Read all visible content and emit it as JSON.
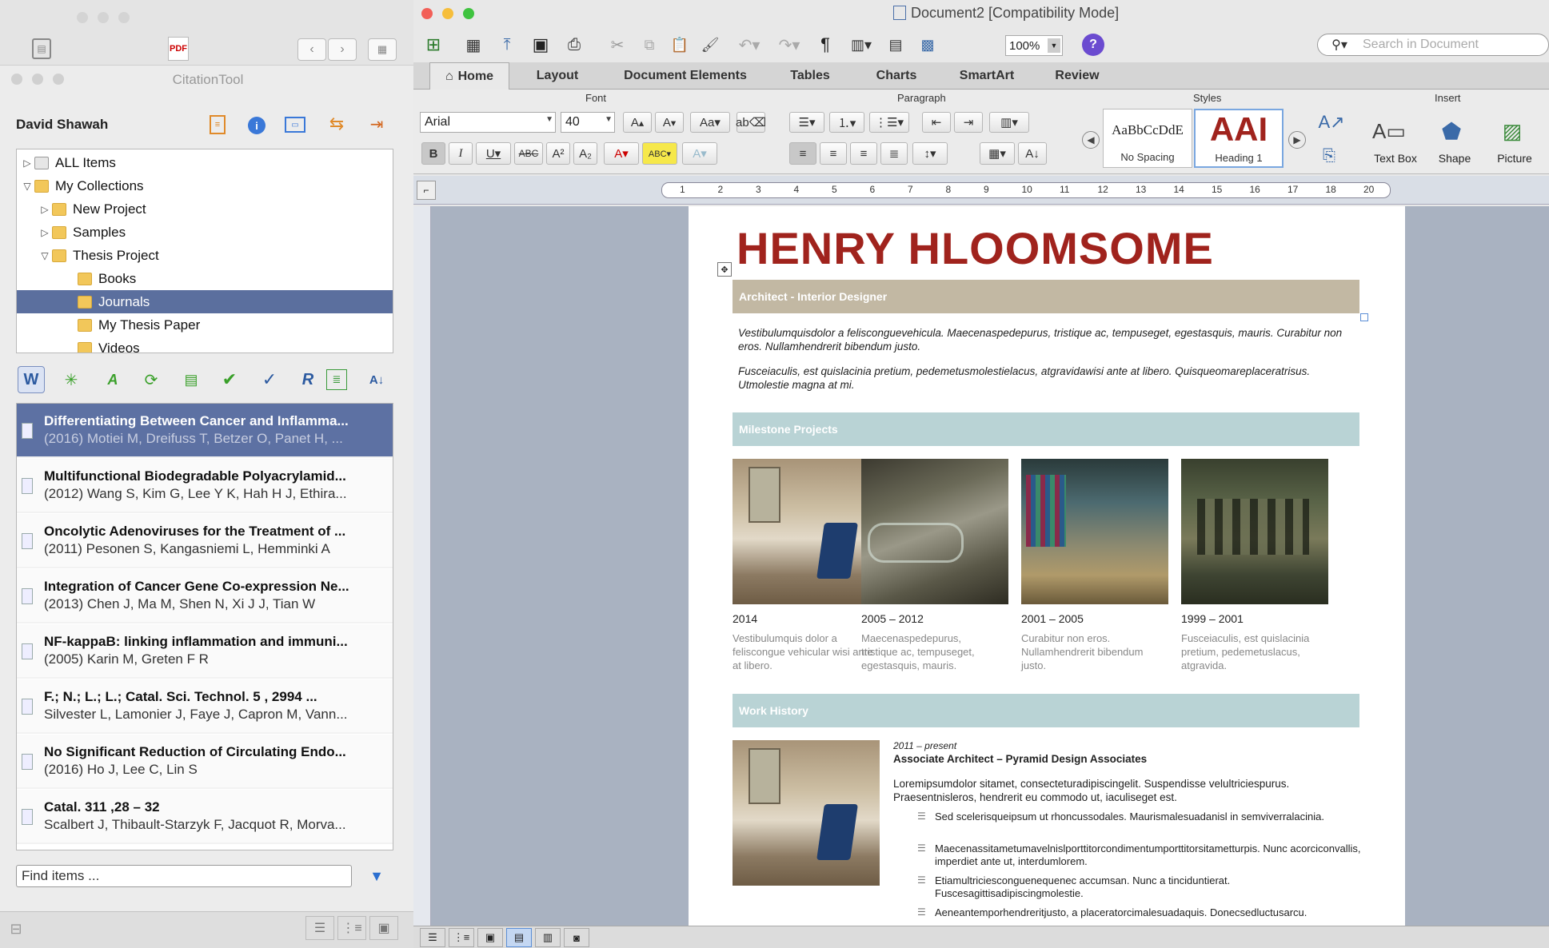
{
  "citation_window": {
    "title": "CitationTool",
    "user": "David Shawah",
    "tree": [
      {
        "label": "ALL Items"
      },
      {
        "label": "My Collections"
      },
      {
        "label": "New Project"
      },
      {
        "label": "Samples"
      },
      {
        "label": "Thesis Project"
      },
      {
        "label": "Books"
      },
      {
        "label": "Journals",
        "selected": true
      },
      {
        "label": "My Thesis Paper"
      },
      {
        "label": "Videos"
      }
    ],
    "items": [
      {
        "title": "Differentiating Between Cancer and Inflamma...",
        "meta": "(2016) Motiei M, Dreifuss T, Betzer O, Panet H, ...",
        "selected": true
      },
      {
        "title": "Multifunctional Biodegradable Polyacrylamid...",
        "meta": "(2012) Wang S, Kim G, Lee Y K, Hah H J, Ethira..."
      },
      {
        "title": "Oncolytic Adenoviruses for the Treatment of ...",
        "meta": "(2011) Pesonen S, Kangasniemi L, Hemminki A"
      },
      {
        "title": "Integration of Cancer Gene Co-expression Ne...",
        "meta": "(2013) Chen J, Ma M, Shen N, Xi J J, Tian W"
      },
      {
        "title": "NF-kappaB: linking inflammation and immuni...",
        "meta": "(2005) Karin M, Greten F R"
      },
      {
        "title": "F.;    N.; L.; L.; Catal. Sci. Technol.  5 , 2994 ...",
        "meta": "Silvester L, Lamonier J, Faye J, Capron M, Vann..."
      },
      {
        "title": "No Significant Reduction of Circulating Endo...",
        "meta": "(2016) Ho J, Lee C, Lin S"
      },
      {
        "title": "Catal.  311 ,28 – 32",
        "meta": "Scalbert J, Thibault-Starzyk F, Jacquot R, Morva..."
      }
    ],
    "find_placeholder": "Find items ..."
  },
  "word": {
    "title": "Document2 [Compatibility Mode]",
    "zoom": "100%",
    "search_placeholder": "Search in Document",
    "tabs": [
      "Home",
      "Layout",
      "Document Elements",
      "Tables",
      "Charts",
      "SmartArt",
      "Review"
    ],
    "groups": {
      "font": "Font",
      "paragraph": "Paragraph",
      "styles": "Styles",
      "insert": "Insert"
    },
    "font_name": "Arial",
    "font_size": "40",
    "styles": {
      "style1_preview": "AaBbCcDdE",
      "style1_name": "No Spacing",
      "style2_preview": "AAI",
      "style2_name": "Heading 1"
    },
    "insert": {
      "textbox": "Text Box",
      "shape": "Shape",
      "picture": "Picture"
    },
    "ruler_numbers": [
      "1",
      "2",
      "3",
      "4",
      "5",
      "6",
      "7",
      "8",
      "9",
      "10",
      "11",
      "12",
      "13",
      "14",
      "15",
      "16",
      "17",
      "18",
      "20"
    ],
    "document": {
      "name": "HENRY HLOOMSOME",
      "subtitle": "Architect - Interior Designer",
      "intro1": "Vestibulumquisdolor a felisconguevehicula. Maecenaspedepurus, tristique ac, tempuseget, egestasquis, mauris. Curabitur non eros. Nullamhendrerit bibendum justo.",
      "intro2": "Fusceiaculis, est quislacinia pretium, pedemetusmolestielacus, atgravidawisi ante at libero. Quisqueomareplaceratrisus. Utmolestie magna at mi.",
      "milestone_header": "Milestone Projects",
      "milestones": [
        {
          "year": "2014",
          "caption": "Vestibulumquis dolor a feliscongue vehicular wisi ante at libero."
        },
        {
          "year": "2005 – 2012",
          "caption": "Maecenaspedepurus, tristique ac, tempuseget, egestasquis, mauris."
        },
        {
          "year": "2001 – 2005",
          "caption": "Curabitur non eros. Nullamhendrerit bibendum justo."
        },
        {
          "year": "1999 – 2001",
          "caption": "Fusceiaculis, est quislacinia pretium, pedemetuslacus, atgravida."
        }
      ],
      "work_header": "Work History",
      "job_period": "2011 – present",
      "job_title": "Associate Architect – Pyramid Design Associates",
      "job_desc": "Loremipsumdolor sitamet, consecteturadipiscingelit. Suspendisse velultriciespurus. Praesentnisleros, hendrerit eu commodo ut, iaculiseget est.",
      "bullets": [
        "Sed scelerisqueipsum ut rhoncussodales. Maurismalesuadanisl in semviverralacinia.",
        "Maecenassitametumavelnislporttitorcondimentumporttitorsitametturpis. Nunc acorciconvallis, imperdiet ante ut, interdumlorem.",
        "Etiamultriciesconguenequenec accumsan. Nunc a tinciduntierat. Fuscesagittisadipiscingmolestie.",
        "Aeneantemporhendreritjusto, a placeratorcimalesuadaquis. Donecsedluctusarcu."
      ]
    }
  },
  "colors": {
    "name_red": "#a0231d",
    "tan_bar": "#c2b8a3",
    "teal_bar": "#b9d3d5",
    "selection": "#5d71a3"
  }
}
